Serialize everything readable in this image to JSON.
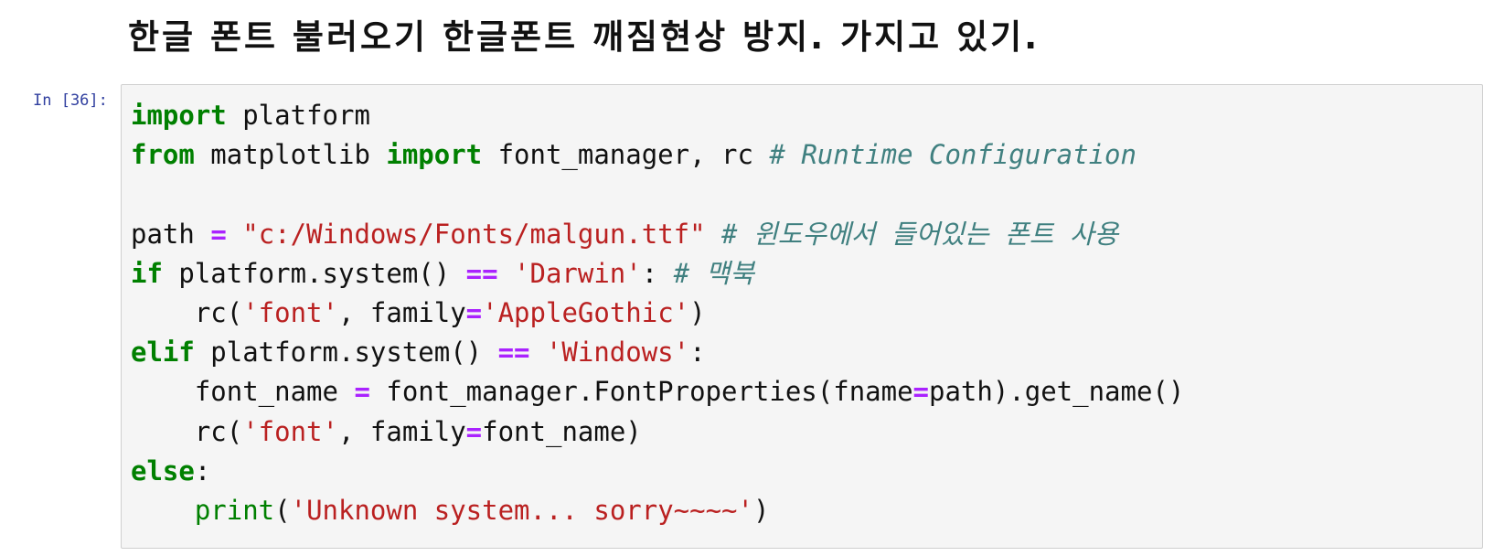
{
  "heading": "한글 폰트 불러오기 한글폰트 깨짐현상 방지. 가지고 있기.",
  "cell": {
    "prompt": "In [36]:",
    "lines": [
      {
        "segments": [
          {
            "text": "import",
            "type": "kw"
          },
          {
            "text": " platform",
            "type": "plain"
          }
        ]
      },
      {
        "segments": [
          {
            "text": "from",
            "type": "kw"
          },
          {
            "text": " matplotlib ",
            "type": "plain"
          },
          {
            "text": "import",
            "type": "kw"
          },
          {
            "text": " font_manager, rc ",
            "type": "plain"
          },
          {
            "text": "# Runtime Configuration",
            "type": "cm"
          }
        ]
      },
      {
        "segments": []
      },
      {
        "segments": [
          {
            "text": "path ",
            "type": "plain"
          },
          {
            "text": "=",
            "type": "op"
          },
          {
            "text": " ",
            "type": "plain"
          },
          {
            "text": "\"c:/Windows/Fonts/malgun.ttf\"",
            "type": "str"
          },
          {
            "text": " ",
            "type": "plain"
          },
          {
            "text": "# 윈도우에서 들어있는 폰트 사용",
            "type": "cm"
          }
        ]
      },
      {
        "segments": [
          {
            "text": "if",
            "type": "kw"
          },
          {
            "text": " platform.system() ",
            "type": "plain"
          },
          {
            "text": "==",
            "type": "op"
          },
          {
            "text": " ",
            "type": "plain"
          },
          {
            "text": "'Darwin'",
            "type": "str"
          },
          {
            "text": ": ",
            "type": "plain"
          },
          {
            "text": "# 맥북",
            "type": "cm"
          }
        ]
      },
      {
        "segments": [
          {
            "text": "    rc(",
            "type": "plain"
          },
          {
            "text": "'font'",
            "type": "str"
          },
          {
            "text": ", family",
            "type": "plain"
          },
          {
            "text": "=",
            "type": "op"
          },
          {
            "text": "'AppleGothic'",
            "type": "str"
          },
          {
            "text": ")",
            "type": "plain"
          }
        ]
      },
      {
        "segments": [
          {
            "text": "elif",
            "type": "kw"
          },
          {
            "text": " platform.system() ",
            "type": "plain"
          },
          {
            "text": "==",
            "type": "op"
          },
          {
            "text": " ",
            "type": "plain"
          },
          {
            "text": "'Windows'",
            "type": "str"
          },
          {
            "text": ":",
            "type": "plain"
          }
        ]
      },
      {
        "segments": [
          {
            "text": "    font_name ",
            "type": "plain"
          },
          {
            "text": "=",
            "type": "op"
          },
          {
            "text": " font_manager.FontProperties(fname",
            "type": "plain"
          },
          {
            "text": "=",
            "type": "op"
          },
          {
            "text": "path).get_name()",
            "type": "plain"
          }
        ]
      },
      {
        "segments": [
          {
            "text": "    rc(",
            "type": "plain"
          },
          {
            "text": "'font'",
            "type": "str"
          },
          {
            "text": ", family",
            "type": "plain"
          },
          {
            "text": "=",
            "type": "op"
          },
          {
            "text": "font_name)",
            "type": "plain"
          }
        ]
      },
      {
        "segments": [
          {
            "text": "else",
            "type": "kw"
          },
          {
            "text": ":",
            "type": "plain"
          }
        ]
      },
      {
        "segments": [
          {
            "text": "    ",
            "type": "plain"
          },
          {
            "text": "print",
            "type": "bi"
          },
          {
            "text": "(",
            "type": "plain"
          },
          {
            "text": "'Unknown system... sorry~~~~'",
            "type": "str"
          },
          {
            "text": ")",
            "type": "plain"
          }
        ]
      }
    ]
  },
  "colors": {
    "keyword": "#008000",
    "operator": "#aa22ff",
    "string": "#ba2121",
    "comment": "#408080",
    "prompt": "#303f9f",
    "cell_background": "#f5f5f5",
    "cell_border": "#cfcfcf"
  }
}
